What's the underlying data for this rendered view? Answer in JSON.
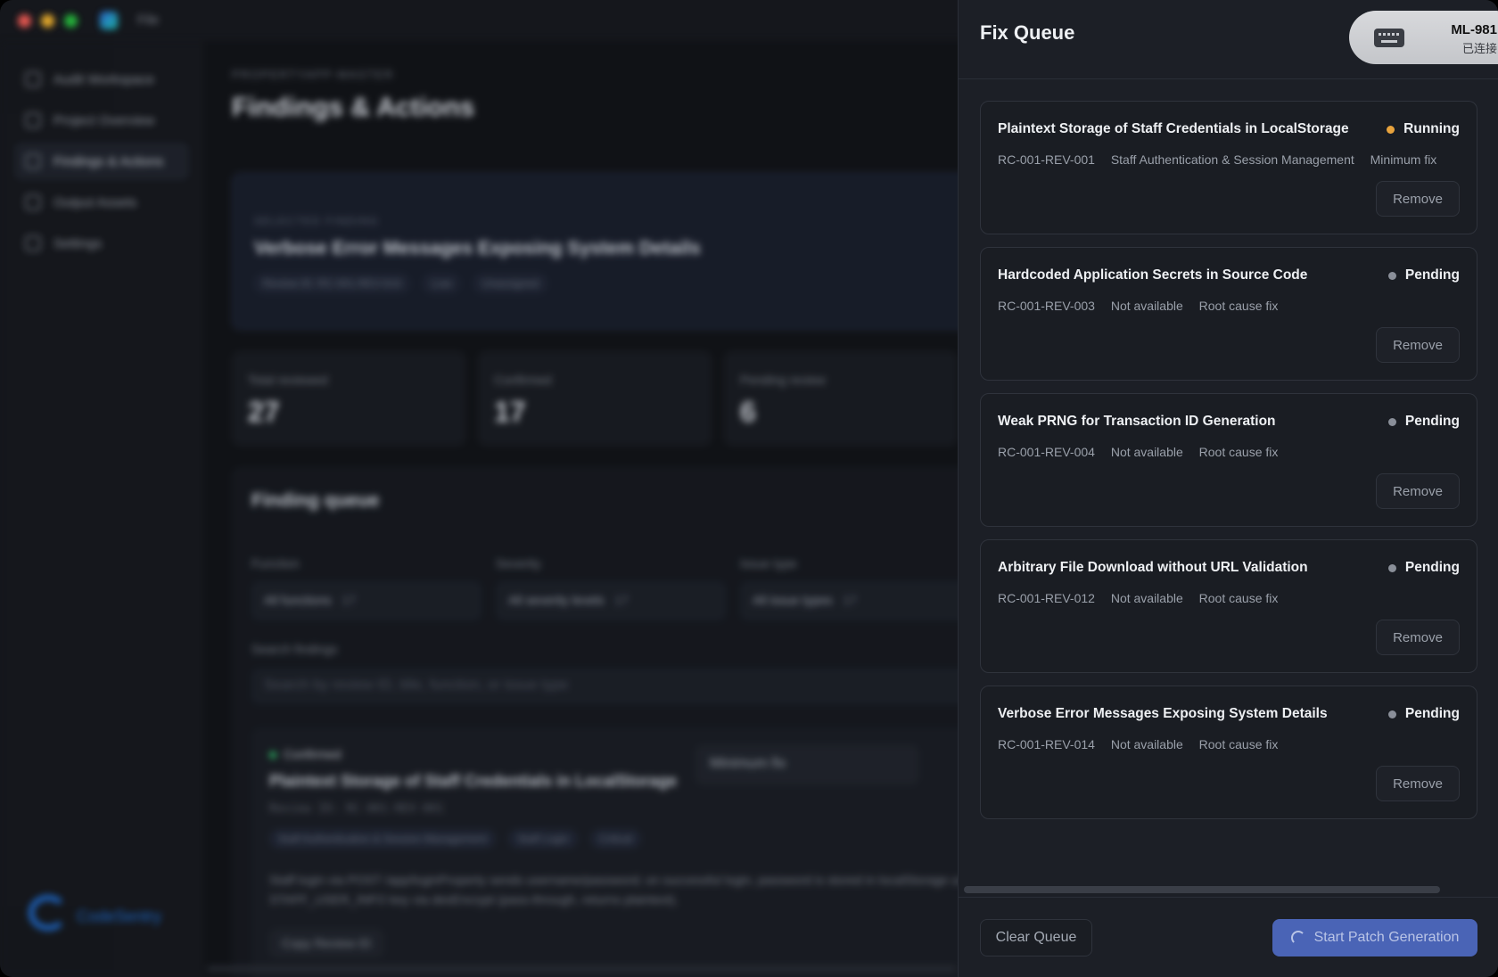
{
  "window": {
    "menu_file": "File"
  },
  "sidebar": {
    "items": [
      {
        "label": "Audit Workspace",
        "icon": "workspace-icon"
      },
      {
        "label": "Project Overview",
        "icon": "overview-icon"
      },
      {
        "label": "Findings & Actions",
        "icon": "findings-icon",
        "active": true
      },
      {
        "label": "Output Assets",
        "icon": "assets-icon"
      },
      {
        "label": "Settings",
        "icon": "settings-icon"
      }
    ],
    "logo_text": "CodeSentry"
  },
  "main": {
    "breadcrumb": "PROPERTYAPP-MASTER",
    "title": "Findings & Actions",
    "selected": {
      "label": "SELECTED FINDING",
      "title": "Verbose Error Messages Exposing System Details",
      "chips": [
        "Review ID: RC-001-REV-014",
        "Low",
        "Unassigned"
      ]
    },
    "stats": [
      {
        "label": "Total reviewed",
        "value": "27"
      },
      {
        "label": "Confirmed",
        "value": "17"
      },
      {
        "label": "Pending review",
        "value": "6"
      }
    ],
    "queue": {
      "title": "Finding queue",
      "filters": [
        {
          "label": "Function",
          "value": "All functions",
          "count": "17"
        },
        {
          "label": "Severity",
          "value": "All severity levels",
          "count": "17"
        },
        {
          "label": "Issue type",
          "value": "All issue types",
          "count": "17"
        }
      ],
      "search_label": "Search findings",
      "search_placeholder": "Search by review ID, title, function, or issue type",
      "finding": {
        "status": "Confirmed",
        "title": "Plaintext Storage of Staff Credentials in LocalStorage",
        "review_id": "Review ID: RC-001-REV-001",
        "chips": [
          "Staff Authentication & Session Management",
          "Staff Login",
          "Critical"
        ],
        "description": "Staff login via POST /app/loginProperty sends username/password; on successful login, password is stored in localStorage under STAFF_USER_INFO key via desEncrypt (pass-through, returns plaintext).",
        "copy_label": "Copy Review ID",
        "fix_select": "Minimum fix"
      }
    }
  },
  "drawer": {
    "title": "Fix Queue",
    "device": {
      "name": "ML-981",
      "status": "已连接",
      "icon": "keyboard-icon"
    },
    "items": [
      {
        "title": "Plaintext Storage of Staff Credentials in LocalStorage",
        "status": "Running",
        "status_color": "#e8a33d",
        "id": "RC-001-REV-001",
        "function": "Staff Authentication & Session Management",
        "fix": "Minimum fix",
        "remove": "Remove"
      },
      {
        "title": "Hardcoded Application Secrets in Source Code",
        "status": "Pending",
        "status_color": "#8a8f99",
        "id": "RC-001-REV-003",
        "function": "Not available",
        "fix": "Root cause fix",
        "remove": "Remove"
      },
      {
        "title": "Weak PRNG for Transaction ID Generation",
        "status": "Pending",
        "status_color": "#8a8f99",
        "id": "RC-001-REV-004",
        "function": "Not available",
        "fix": "Root cause fix",
        "remove": "Remove"
      },
      {
        "title": "Arbitrary File Download without URL Validation",
        "status": "Pending",
        "status_color": "#8a8f99",
        "id": "RC-001-REV-012",
        "function": "Not available",
        "fix": "Root cause fix",
        "remove": "Remove"
      },
      {
        "title": "Verbose Error Messages Exposing System Details",
        "status": "Pending",
        "status_color": "#8a8f99",
        "id": "RC-001-REV-014",
        "function": "Not available",
        "fix": "Root cause fix",
        "remove": "Remove"
      }
    ],
    "clear_label": "Clear Queue",
    "start_label": "Start Patch Generation"
  }
}
